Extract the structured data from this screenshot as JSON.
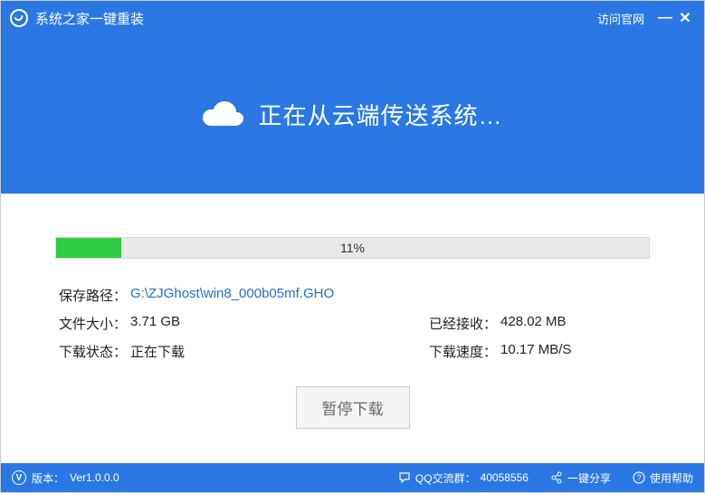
{
  "titlebar": {
    "title": "系统之家一键重装",
    "visit_link": "访问官网"
  },
  "hero": {
    "text": "正在从云端传送系统…"
  },
  "progress": {
    "percent": 11,
    "percent_text": "11%"
  },
  "info": {
    "save_path_label": "保存路径：",
    "save_path_value": "G:\\ZJGhost\\win8_000b05mf.GHO",
    "file_size_label": "文件大小：",
    "file_size_value": "3.71 GB",
    "received_label": "已经接收：",
    "received_value": "428.02 MB",
    "status_label": "下载状态：",
    "status_value": "正在下载",
    "speed_label": "下载速度：",
    "speed_value": "10.17 MB/S"
  },
  "actions": {
    "pause_label": "暂停下载"
  },
  "footer": {
    "version_label": "版本：",
    "version_value": "Ver1.0.0.0",
    "qq_label": "QQ交流群：",
    "qq_value": "40058556",
    "share_label": "一键分享",
    "help_label": "使用帮助"
  },
  "colors": {
    "primary": "#2b78e4",
    "progress": "#2ecc40",
    "link": "#1f6fd1"
  }
}
